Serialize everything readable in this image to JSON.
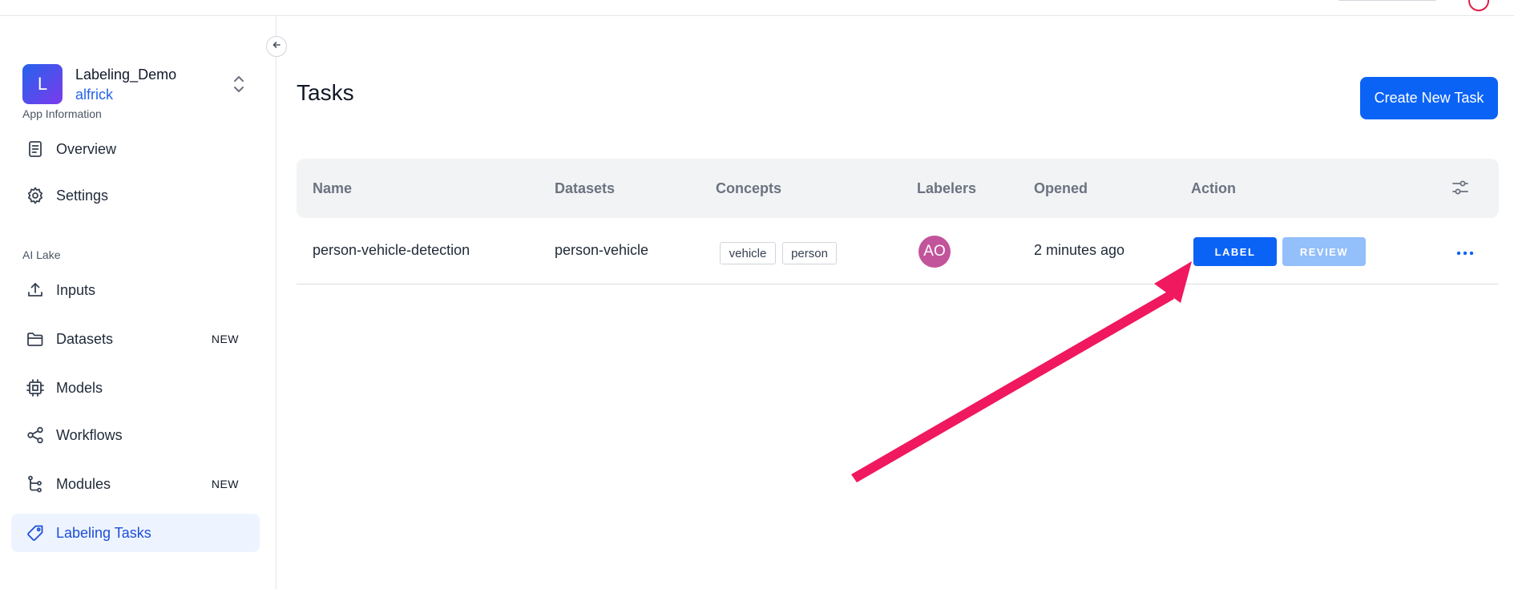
{
  "app": {
    "logo_letter": "L",
    "name": "Labeling_Demo",
    "user": "alfrick"
  },
  "sidebar": {
    "sections": [
      {
        "label": "App Information"
      },
      {
        "label": "AI Lake"
      }
    ],
    "items": [
      {
        "label": "Overview",
        "icon": "document-icon"
      },
      {
        "label": "Settings",
        "icon": "gear-icon"
      },
      {
        "label": "Inputs",
        "icon": "upload-icon"
      },
      {
        "label": "Datasets",
        "icon": "folder-icon",
        "badge": "NEW"
      },
      {
        "label": "Models",
        "icon": "chip-icon"
      },
      {
        "label": "Workflows",
        "icon": "share-icon"
      },
      {
        "label": "Modules",
        "icon": "branch-icon",
        "badge": "NEW"
      },
      {
        "label": "Labeling Tasks",
        "icon": "tag-icon",
        "active": true
      }
    ]
  },
  "main": {
    "title": "Tasks",
    "create_button": "Create New Task",
    "columns": [
      "Name",
      "Datasets",
      "Concepts",
      "Labelers",
      "Opened",
      "Action"
    ],
    "rows": [
      {
        "name": "person-vehicle-detection",
        "dataset": "person-vehicle",
        "concepts": [
          "vehicle",
          "person"
        ],
        "labeler_initials": "AO",
        "opened": "2 minutes ago",
        "actions": [
          "LABEL",
          "REVIEW"
        ]
      }
    ]
  },
  "colors": {
    "primary": "#0b63f6",
    "primary_disabled": "#93bffa",
    "annotation_arrow": "#f0185e",
    "avatar": "#c2549b"
  }
}
